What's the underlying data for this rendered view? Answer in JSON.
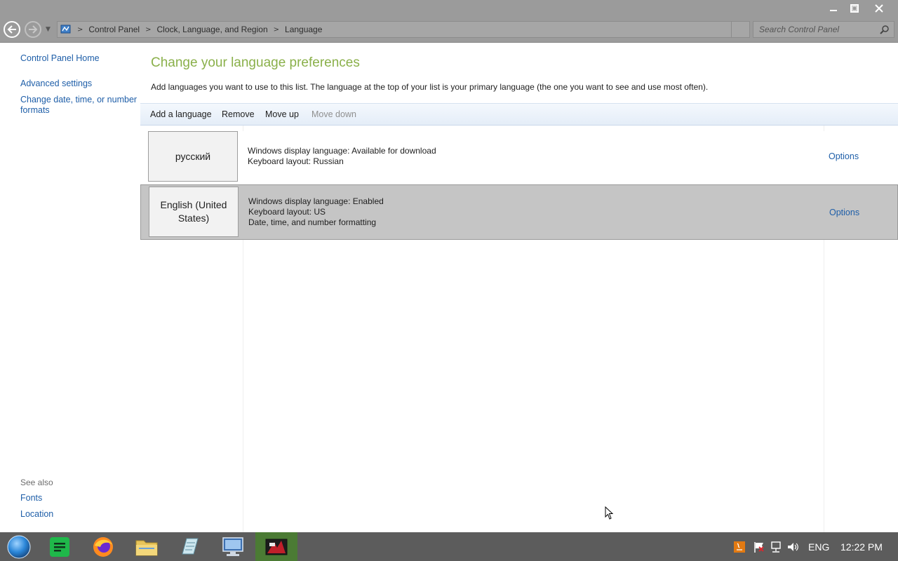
{
  "window": {
    "controls": [
      "minimize",
      "restore",
      "close"
    ]
  },
  "address": {
    "breadcrumb": [
      "Control Panel",
      "Clock, Language, and Region",
      "Language"
    ],
    "search_placeholder": "Search Control Panel"
  },
  "left_nav": {
    "home": "Control Panel Home",
    "advanced": "Advanced settings",
    "datetime_line1": "Change date, time, or number",
    "datetime_line2": "formats",
    "see_also": "See also",
    "fonts": "Fonts",
    "location": "Location"
  },
  "main": {
    "title": "Change your language preferences",
    "description": "Add languages you want to use to this list. The language at the top of your list is your primary language (the one you want to see and use most often).",
    "toolbar": {
      "add": "Add a language",
      "remove": "Remove",
      "move_up": "Move up",
      "move_down": "Move down"
    },
    "languages": [
      {
        "name": "русский",
        "lines": [
          "Windows display language: Available for download",
          "Keyboard layout: Russian"
        ],
        "options": "Options",
        "selected": false
      },
      {
        "name": "English (United States)",
        "lines": [
          "Windows display language: Enabled",
          "Keyboard layout: US",
          "Date, time, and number formatting"
        ],
        "options": "Options",
        "selected": true
      }
    ]
  },
  "taskbar": {
    "apps": [
      "start-orb",
      "notes-app",
      "firefox",
      "file-explorer",
      "notepad",
      "remote-desktop",
      "media-app"
    ],
    "input_language": "ENG",
    "clock": "12:22 PM"
  },
  "colors": {
    "title_green": "#8ab04a",
    "link_blue": "#1e5ea8",
    "chrome_gray": "#9b9b9b",
    "taskbar": "#5c5c5c",
    "selected_row": "#c5c5c5"
  }
}
